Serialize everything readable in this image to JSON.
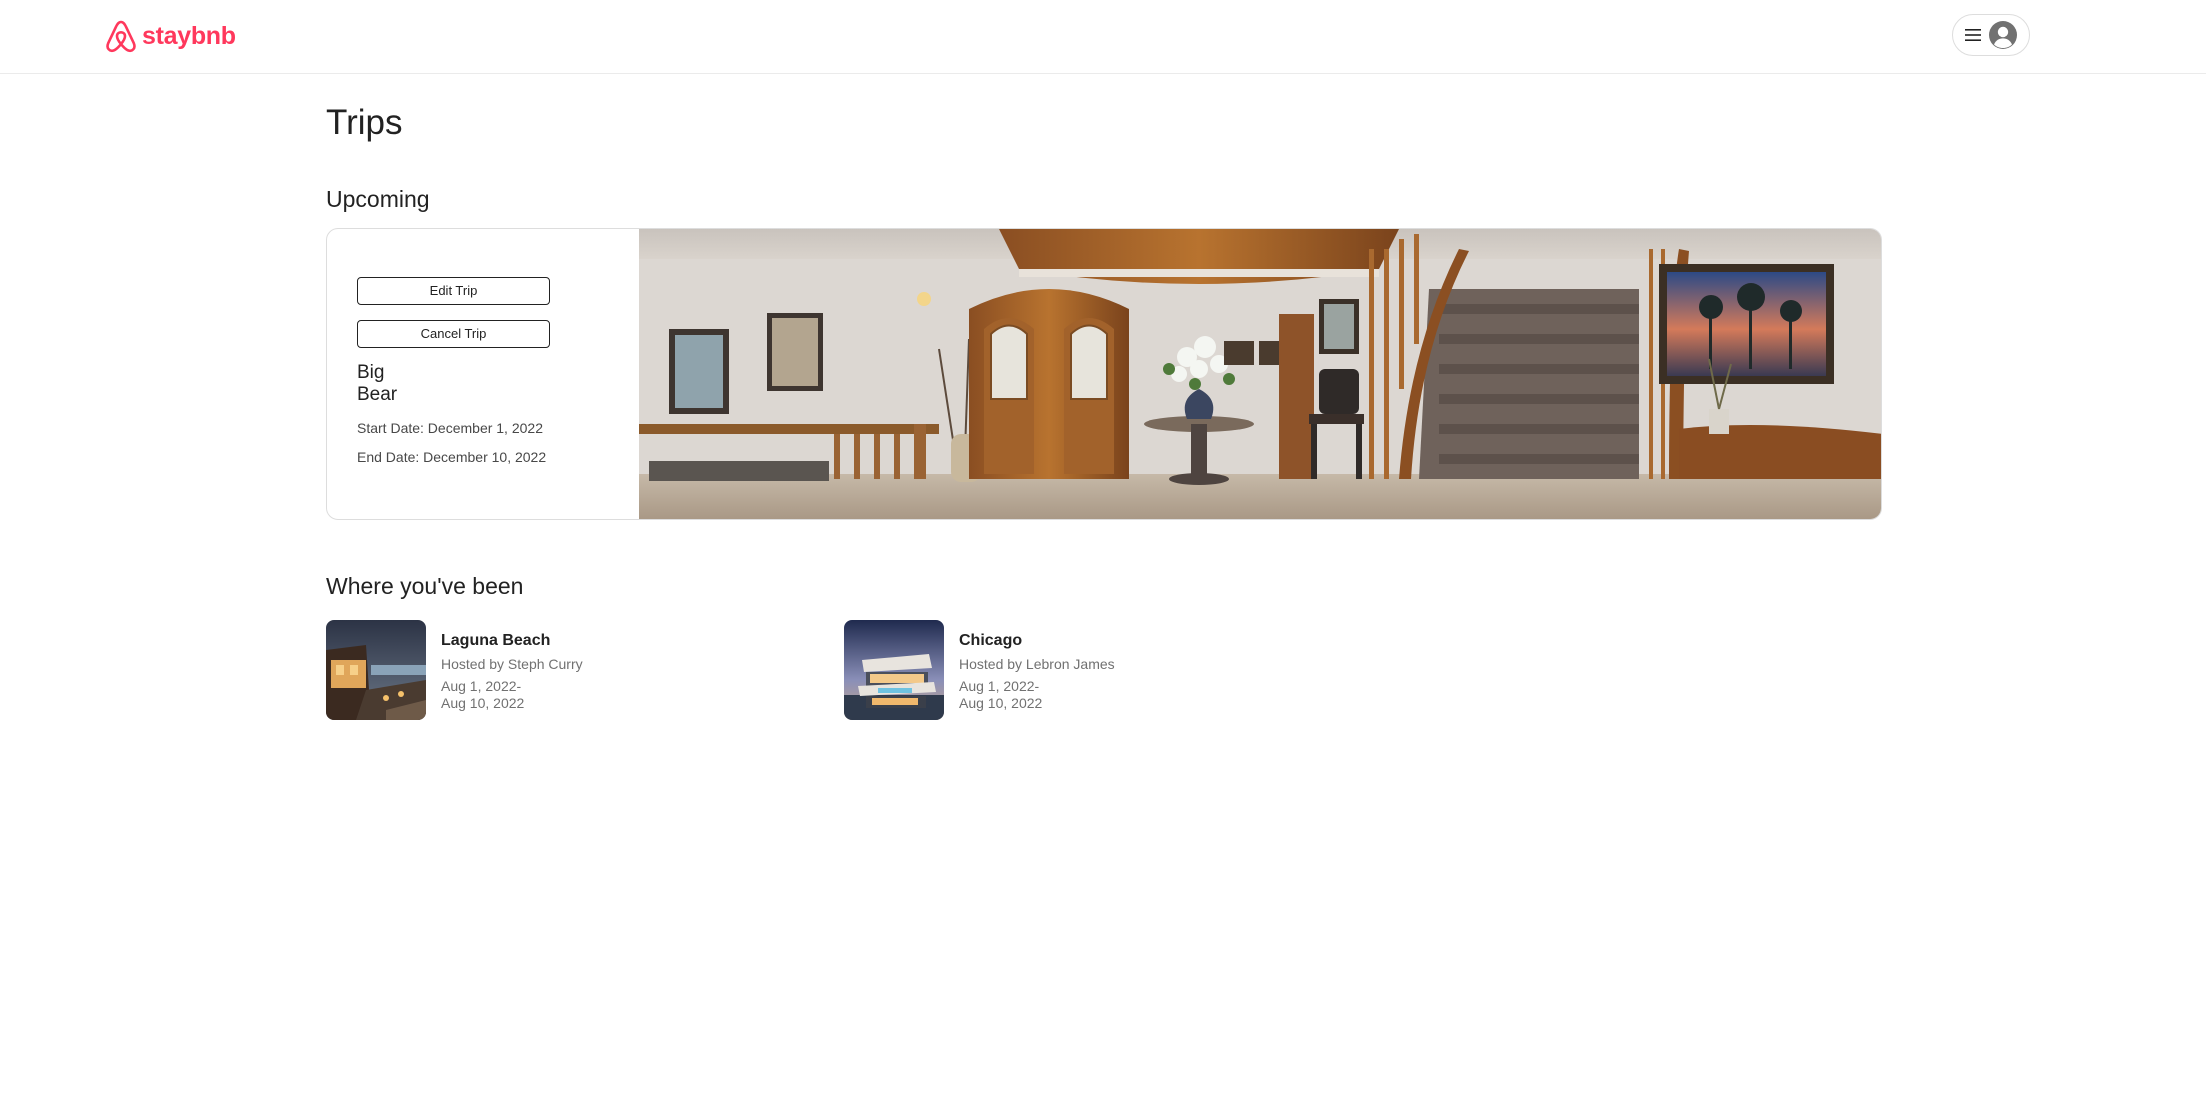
{
  "header": {
    "brand": "staybnb",
    "brand_color": "#ff385c",
    "logo_icon": "airbnb-logo-icon",
    "menu_icon": "hamburger-menu-icon",
    "avatar_icon": "user-avatar-icon"
  },
  "page": {
    "title": "Trips"
  },
  "upcoming": {
    "heading": "Upcoming",
    "trip": {
      "edit_label": "Edit Trip",
      "cancel_label": "Cancel Trip",
      "name": "Big Bear",
      "start_date": "Start Date: December 1, 2022",
      "end_date": "End Date: December 10, 2022",
      "photo": "Interior photo of entry hall with wooden staircase"
    }
  },
  "past": {
    "heading": "Where you've been",
    "trips": [
      {
        "title": "Laguna Beach",
        "host": "Hosted by Steph Curry",
        "dates_line1": "Aug 1, 2022-",
        "dates_line2": "Aug 10, 2022"
      },
      {
        "title": "Chicago",
        "host": "Hosted by Lebron James",
        "dates_line1": "Aug 1, 2022-",
        "dates_line2": "Aug 10, 2022"
      }
    ]
  }
}
